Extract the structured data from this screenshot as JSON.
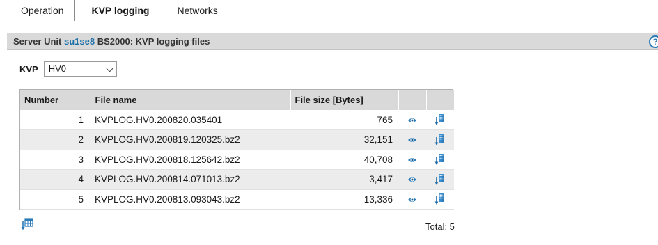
{
  "tabs": [
    {
      "label": "Operation"
    },
    {
      "label": "KVP logging"
    },
    {
      "label": "Networks"
    }
  ],
  "panel": {
    "title_prefix": "Server Unit",
    "server_name": "su1se8",
    "title_suffix": "BS2000: KVP logging files",
    "help_label": "?"
  },
  "kvp": {
    "label": "KVP",
    "selected": "HV0"
  },
  "table": {
    "headers": {
      "number": "Number",
      "file_name": "File name",
      "file_size": "File size [Bytes]"
    },
    "rows": [
      {
        "number": "1",
        "file_name": "KVPLOG.HV0.200820.035401",
        "size": "765"
      },
      {
        "number": "2",
        "file_name": "KVPLOG.HV0.200819.120325.bz2",
        "size": "32,151"
      },
      {
        "number": "3",
        "file_name": "KVPLOG.HV0.200818.125642.bz2",
        "size": "40,708"
      },
      {
        "number": "4",
        "file_name": "KVPLOG.HV0.200814.071013.bz2",
        "size": "3,417"
      },
      {
        "number": "5",
        "file_name": "KVPLOG.HV0.200813.093043.bz2",
        "size": "13,336"
      }
    ]
  },
  "footer": {
    "total": "Total: 5"
  },
  "colors": {
    "accent": "#1a6fa8",
    "header_bg": "#d9d9d9",
    "alt_row_bg": "#ececec"
  },
  "icons": {
    "view": "eye-icon",
    "download": "download-icon",
    "export": "export-table-icon",
    "help": "help-icon"
  }
}
